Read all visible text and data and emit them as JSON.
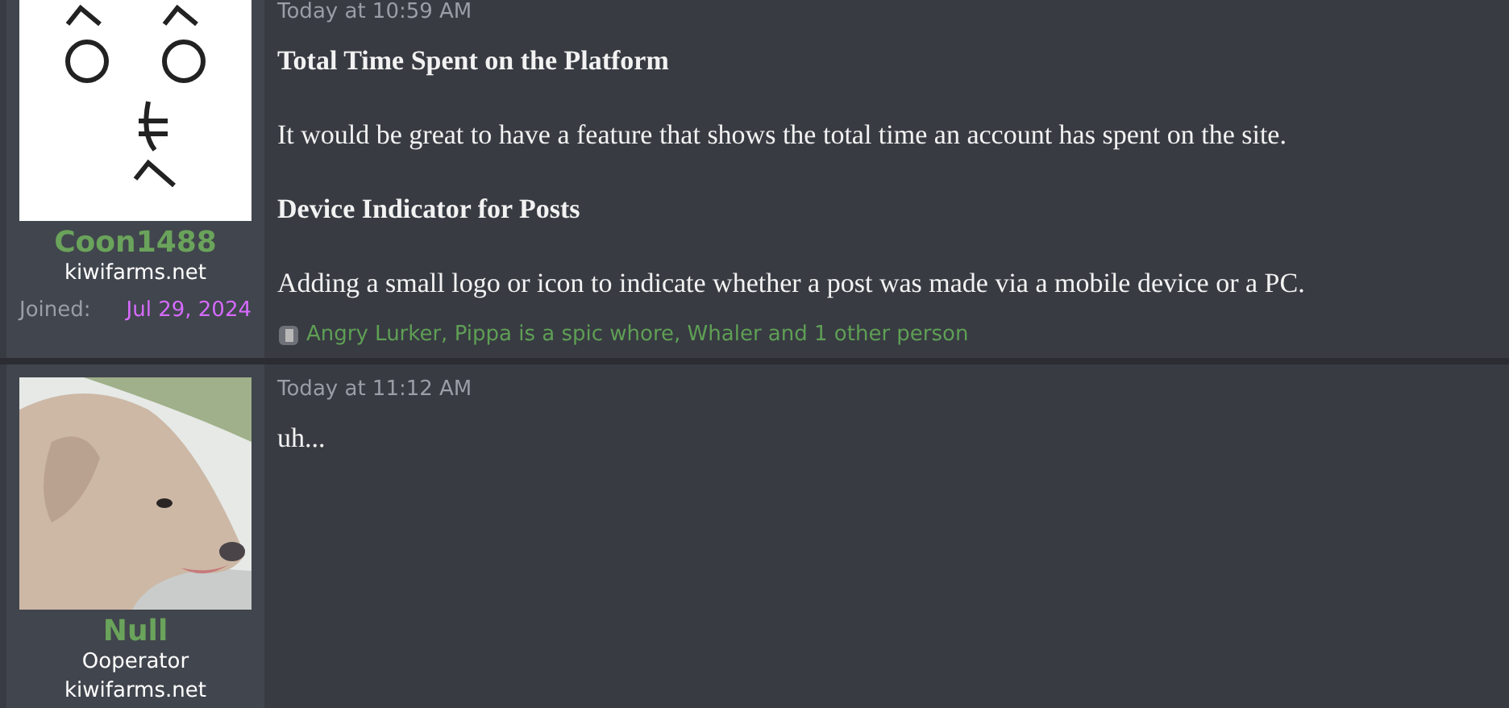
{
  "posts": [
    {
      "timestamp": "Today at 10:59 AM",
      "author": {
        "name": "Coon1488",
        "user_lines": [
          "kiwifarms.net"
        ],
        "joined": {
          "label": "Joined:",
          "date": "Jul 29, 2024"
        }
      },
      "body": [
        {
          "kind": "heading",
          "text": "Total Time Spent on the Platform"
        },
        {
          "kind": "paragraph",
          "text": "It would be great to have a feature that shows the total time an account has spent on the site."
        },
        {
          "kind": "heading",
          "text": "Device Indicator for Posts"
        },
        {
          "kind": "paragraph",
          "text": "Adding a small logo or icon to indicate whether a post was made via a mobile device or a PC."
        }
      ],
      "reactions": "Angry Lurker, Pippa is a spic whore, Whaler and 1 other person"
    },
    {
      "timestamp": "Today at 11:12 AM",
      "author": {
        "name": "Null",
        "user_lines": [
          "Ooperator",
          "kiwifarms.net"
        ]
      },
      "body": [
        {
          "kind": "paragraph",
          "text": "uh..."
        }
      ]
    }
  ]
}
